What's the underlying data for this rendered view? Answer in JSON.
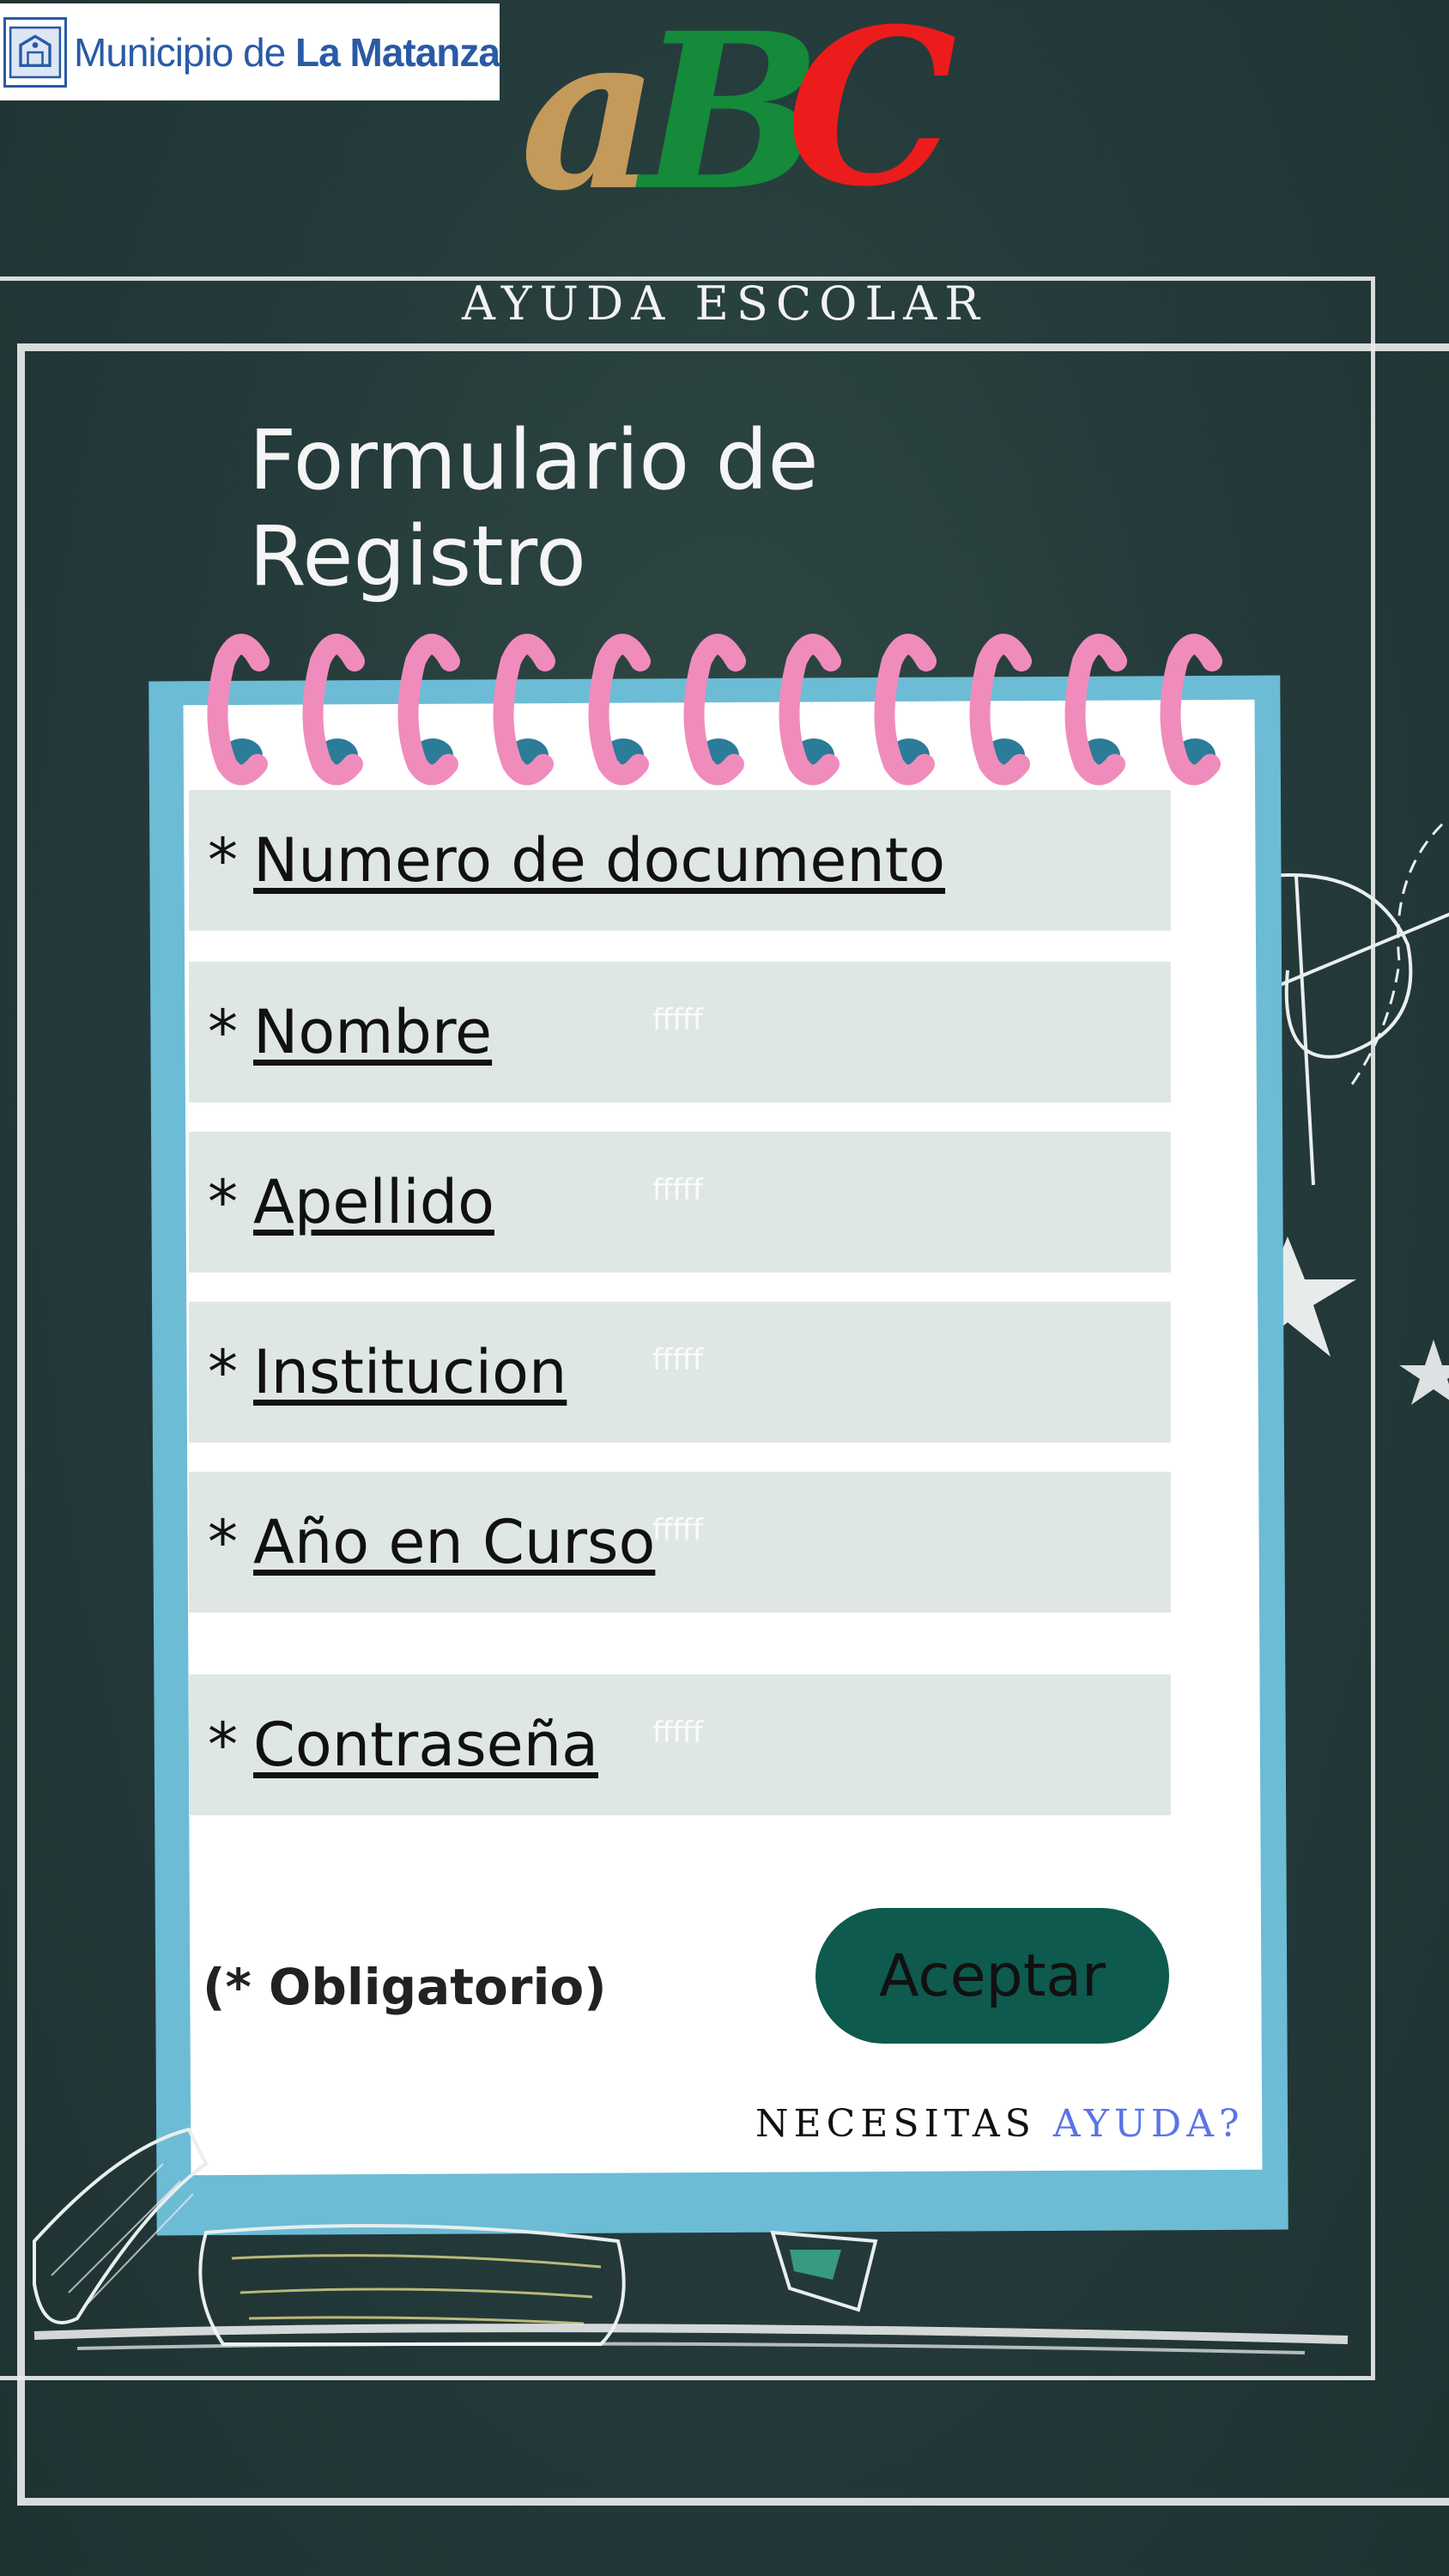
{
  "header": {
    "logo_text_regular": "Municipio de ",
    "logo_text_bold": "La Matanza",
    "abc_letters": [
      "a",
      "B",
      "C"
    ],
    "abc_colors": [
      "#c49a5a",
      "#148a3a",
      "#ec1c1c"
    ],
    "subtitle": "AYUDA ESCOLAR"
  },
  "form": {
    "title": "Formulario de Registro",
    "fields": [
      {
        "star": "*",
        "label": "Numero de documento",
        "ghost": ""
      },
      {
        "star": "*",
        "label": "Nombre",
        "ghost": "fffff"
      },
      {
        "star": "*",
        "label": "Apellido",
        "ghost": "fffff"
      },
      {
        "star": "*",
        "label": "Institucion",
        "ghost": "fffff"
      },
      {
        "star": "*",
        "label": "Año en Curso",
        "ghost": "fffff"
      },
      {
        "star": "*",
        "label": "Contraseña",
        "ghost": "fffff"
      }
    ],
    "required_note": "(* Obligatorio)",
    "submit_label": "Aceptar",
    "help_text": "NECESITAS ",
    "help_link": "AYUDA?"
  },
  "icons": {
    "logo": "municipal-crest-icon",
    "rings": "spiral-ring-icon"
  },
  "colors": {
    "background": "#24393a",
    "notebook_border": "#6cbcd6",
    "field_bg": "#dfe7e5",
    "button_bg": "#0e5a4e",
    "ring_pink": "#f08cbc",
    "ring_hole": "#2b7c98",
    "help_link": "#5b73e8"
  }
}
